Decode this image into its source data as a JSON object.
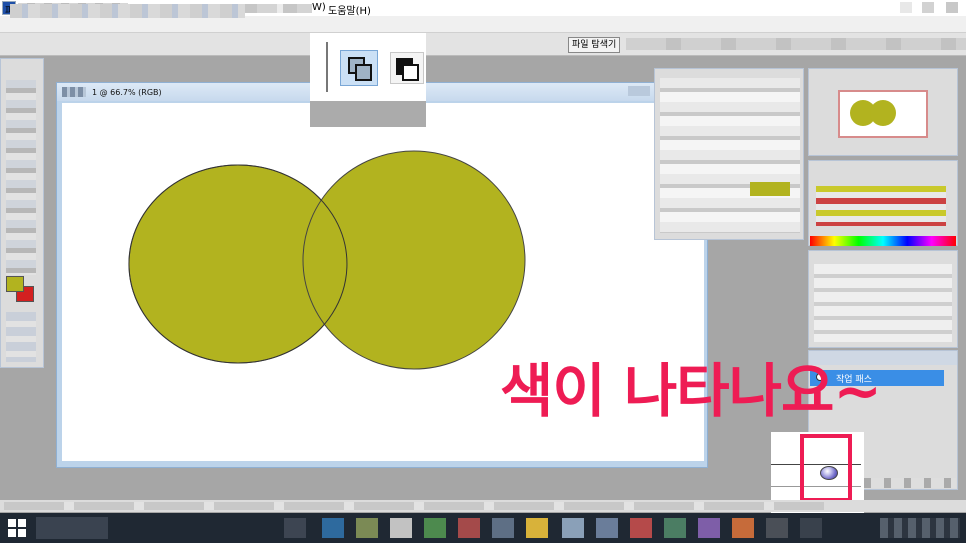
{
  "app": {
    "menu_first_char": "파",
    "menu_w_fragment": "W)",
    "menu_help": "도움말(H)"
  },
  "toolbar": {
    "file_browser_label": "파일 탐색기"
  },
  "document": {
    "title": "1 @ 66.7% (RGB)"
  },
  "shape_color": "#b2b31f",
  "paths_panel": {
    "work_path_label": "작업 패스"
  },
  "annotation": {
    "text": "색이 나타나요~",
    "color": "#ee1c54"
  },
  "icons": {
    "app": "app-icon",
    "shape_overlap_a": "shape-combine-icon",
    "shape_overlap_b": "shape-subtract-icon",
    "fill_path": "fill-path-icon"
  }
}
